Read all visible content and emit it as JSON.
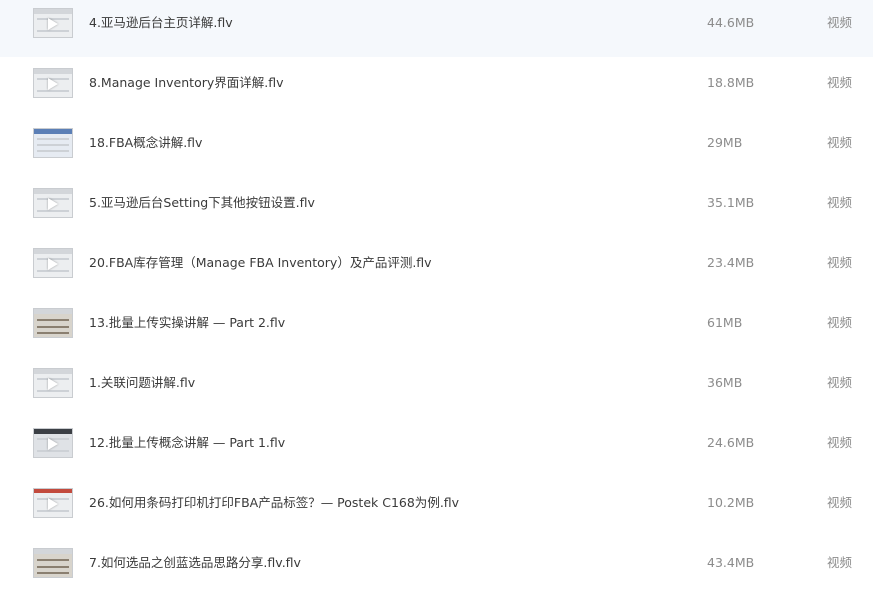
{
  "files": [
    {
      "name": "4.亚马逊后台主页详解.flv",
      "size": "44.6MB",
      "type": "视频",
      "thumb": "thumbnail-icon"
    },
    {
      "name": "8.Manage Inventory界面详解.flv",
      "size": "18.8MB",
      "type": "视频",
      "thumb": "thumbnail-icon"
    },
    {
      "name": "18.FBA概念讲解.flv",
      "size": "29MB",
      "type": "视频",
      "thumb": "thumbnail-icon"
    },
    {
      "name": "5.亚马逊后台Setting下其他按钮设置.flv",
      "size": "35.1MB",
      "type": "视频",
      "thumb": "thumbnail-icon"
    },
    {
      "name": "20.FBA库存管理（Manage FBA Inventory）及产品评测.flv",
      "size": "23.4MB",
      "type": "视频",
      "thumb": "thumbnail-icon"
    },
    {
      "name": "13.批量上传实操讲解 — Part 2.flv",
      "size": "61MB",
      "type": "视频",
      "thumb": "thumbnail-icon"
    },
    {
      "name": "1.关联问题讲解.flv",
      "size": "36MB",
      "type": "视频",
      "thumb": "thumbnail-icon"
    },
    {
      "name": "12.批量上传概念讲解 — Part 1.flv",
      "size": "24.6MB",
      "type": "视频",
      "thumb": "thumbnail-icon"
    },
    {
      "name": "26.如何用条码打印机打印FBA产品标签？— Postek C168为例.flv",
      "size": "10.2MB",
      "type": "视频",
      "thumb": "thumbnail-icon"
    },
    {
      "name": "7.如何选品之创蓝选品思路分享.flv.flv",
      "size": "43.4MB",
      "type": "视频",
      "thumb": "thumbnail-icon"
    }
  ]
}
